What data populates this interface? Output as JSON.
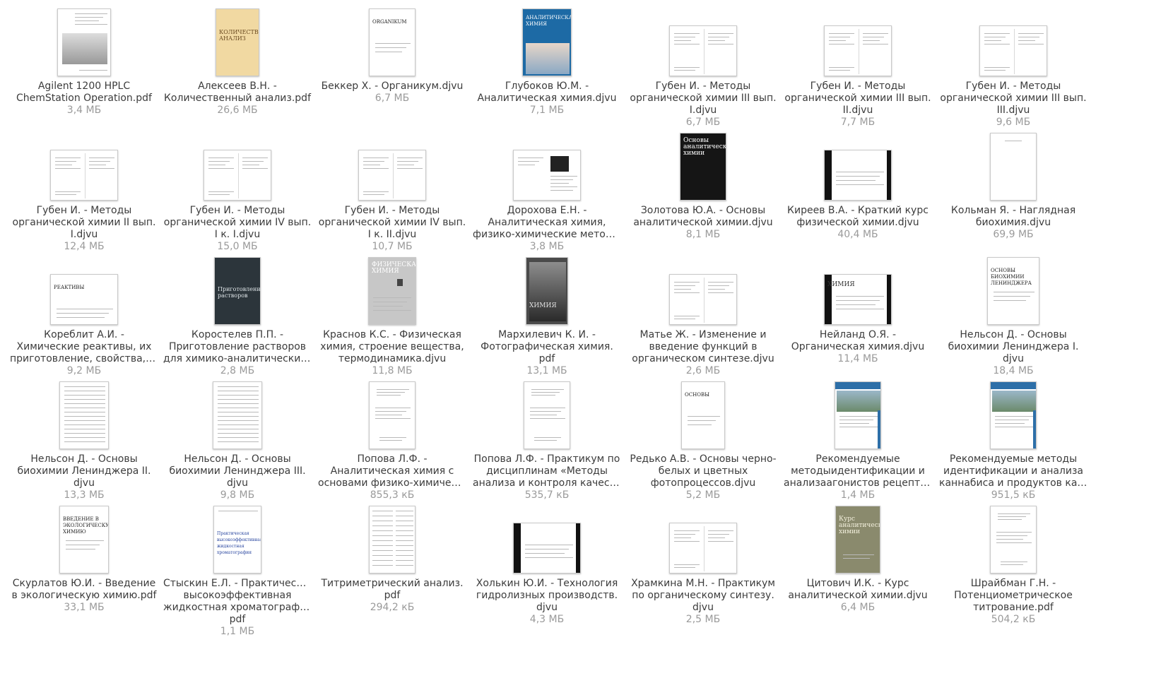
{
  "files": [
    {
      "lines": [
        "Agilent 1200 HPLC",
        "ChemStation Operation.pdf"
      ],
      "size": "3,4 МБ",
      "thumb": "photo-cover",
      "ttext": ""
    },
    {
      "lines": [
        "Алексеев В.Н. -",
        "Количественный анализ.pdf"
      ],
      "size": "26,6 МБ",
      "thumb": "yellow-cover",
      "ttext": "КОЛИЧЕСТВЕННЫЙ АНАЛИЗ"
    },
    {
      "lines": [
        "Беккер Х. - Органикум.djvu"
      ],
      "size": "6,7 МБ",
      "thumb": "title-page",
      "ttext": "ORGANIKUM"
    },
    {
      "lines": [
        "Глубоков Ю.М. -",
        "Аналитическая химия.djvu"
      ],
      "size": "7,1 МБ",
      "thumb": "blue-cover",
      "ttext": "АНАЛИТИЧЕСКАЯ ХИМИЯ"
    },
    {
      "lines": [
        "Губен И. - Методы",
        "органической химии III вып.",
        "I.djvu"
      ],
      "size": "6,7 МБ",
      "thumb": "spread",
      "ttext": ""
    },
    {
      "lines": [
        "Губен И. - Методы",
        "органической химии III вып.",
        "II.djvu"
      ],
      "size": "7,7 МБ",
      "thumb": "spread",
      "ttext": ""
    },
    {
      "lines": [
        "Губен И. - Методы",
        "органической химии III вып.",
        "III.djvu"
      ],
      "size": "9,6 МБ",
      "thumb": "spread",
      "ttext": ""
    },
    {
      "lines": [
        "Губен И. - Методы",
        "органической химии II вып.",
        "I.djvu"
      ],
      "size": "12,4 МБ",
      "thumb": "spread",
      "ttext": ""
    },
    {
      "lines": [
        "Губен И. - Методы",
        "органической химии IV вып.",
        "I к. I.djvu"
      ],
      "size": "15,0 МБ",
      "thumb": "spread",
      "ttext": ""
    },
    {
      "lines": [
        "Губен И. - Методы",
        "органической химии IV вып.",
        "I к. II.djvu"
      ],
      "size": "10,7 МБ",
      "thumb": "spread",
      "ttext": ""
    },
    {
      "lines": [
        "Дорохова Е.Н. -",
        "Аналитическая химия,",
        "физико-химические методы анализа.djvu"
      ],
      "size": "3,8 МБ",
      "thumb": "spread-bold",
      "ttext": ""
    },
    {
      "lines": [
        "Золотова Ю.А. - Основы",
        "аналитической химии.djvu"
      ],
      "size": "8,1 МБ",
      "thumb": "black-cover",
      "ttext": "Основы аналитической химии"
    },
    {
      "lines": [
        "Киреев В.А. - Краткий курс",
        "физической химии.djvu"
      ],
      "size": "40,4 МБ",
      "thumb": "scan-dark",
      "ttext": ""
    },
    {
      "lines": [
        "Кольман Я. - Наглядная",
        "биохимия.djvu"
      ],
      "size": "69,9 МБ",
      "thumb": "blank",
      "ttext": ""
    },
    {
      "lines": [
        "Кореблит А.И. -",
        "Химические реактивы, их",
        "приготовление, свойства, испытание и применение.djvu"
      ],
      "size": "9,2 МБ",
      "thumb": "title-page",
      "ttext": "РЕАКТИВЫ"
    },
    {
      "lines": [
        "Коростелев П.П. -",
        "Приготовление растворов",
        "для химико-аналитических работ.djvu"
      ],
      "size": "2,8 МБ",
      "thumb": "dark-cover",
      "ttext": "Приготовление растворов"
    },
    {
      "lines": [
        "Краснов К.С. - Физическая",
        "химия, строение вещества,",
        "термодинамика.djvu"
      ],
      "size": "11,8 МБ",
      "thumb": "gray-cover",
      "ttext": "ФИЗИЧЕСКАЯ ХИМИЯ"
    },
    {
      "lines": [
        "Мархилевич К. И. -",
        "Фотографическая химия.",
        "pdf"
      ],
      "size": "13,1 МБ",
      "thumb": "photo-dark",
      "ttext": "ХИМИЯ"
    },
    {
      "lines": [
        "Матье Ж. - Изменение и",
        "введение функций в",
        "органическом синтезе.djvu"
      ],
      "size": "2,6 МБ",
      "thumb": "spread",
      "ttext": ""
    },
    {
      "lines": [
        "Нейланд О.Я. -",
        "Органическая химия.djvu"
      ],
      "size": "11,4 МБ",
      "thumb": "scan-dark",
      "ttext": "ХИМИЯ"
    },
    {
      "lines": [
        "Нельсон Д. - Основы",
        "биохимии Ленинджера I.",
        "djvu"
      ],
      "size": "18,4 МБ",
      "thumb": "title-page",
      "ttext": "ОСНОВЫ БИОХИМИИ ЛЕНИНДЖЕРА"
    },
    {
      "lines": [
        "Нельсон Д. - Основы",
        "биохимии Ленинджера II.",
        "djvu"
      ],
      "size": "13,3 МБ",
      "thumb": "text-page",
      "ttext": ""
    },
    {
      "lines": [
        "Нельсон Д. - Основы",
        "биохимии Ленинджера III.",
        "djvu"
      ],
      "size": "9,8 МБ",
      "thumb": "text-page",
      "ttext": ""
    },
    {
      "lines": [
        "Попова Л.Ф. -",
        "Аналитическая химия с",
        "основами физико-химических методов.djvu"
      ],
      "size": "855,3 кБ",
      "thumb": "title-page",
      "ttext": ""
    },
    {
      "lines": [
        "Попова Л.Ф. - Практикум по",
        "дисциплинам «Методы",
        "анализа и контроля качества».pdf"
      ],
      "size": "535,7 кБ",
      "thumb": "title-page",
      "ttext": ""
    },
    {
      "lines": [
        "Редько А.В. - Основы черно-",
        "белых и цветных",
        "фотопроцессов.djvu"
      ],
      "size": "5,2 МБ",
      "thumb": "title-page",
      "ttext": "ОСНОВЫ"
    },
    {
      "lines": [
        "Рекомендуемые",
        "методыидентификации и",
        "анализаагонистов рецепторов.pdf"
      ],
      "size": "1,4 МБ",
      "thumb": "un-cover",
      "ttext": ""
    },
    {
      "lines": [
        "Рекомендуемые методы",
        "идентификации и анализа",
        "каннабиса и продуктов каннабиса.pdf"
      ],
      "size": "951,5 кБ",
      "thumb": "un-cover",
      "ttext": ""
    },
    {
      "lines": [
        "Скурлатов Ю.И. - Введение",
        "в экологическую химию.pdf"
      ],
      "size": "33,1 МБ",
      "thumb": "title-page",
      "ttext": "ВВЕДЕНИЕ В ЭКОЛОГИЧЕСКУЮ ХИМИЮ"
    },
    {
      "lines": [
        "Стыскин Е.Л. - Практическая",
        "высокоэффективная",
        "жидкостная хроматография.",
        "pdf"
      ],
      "size": "1,1 МБ",
      "thumb": "title-blue",
      "ttext": "Практическая высокоэффективная жидкостная хроматография"
    },
    {
      "lines": [
        "Титриметрический анализ.",
        "pdf"
      ],
      "size": "294,2 кБ",
      "thumb": "table-page",
      "ttext": ""
    },
    {
      "lines": [
        "Холькин Ю.И. - Технология",
        "гидролизных производств.",
        "djvu"
      ],
      "size": "4,3 МБ",
      "thumb": "scan-dark",
      "ttext": ""
    },
    {
      "lines": [
        "Храмкина М.Н. - Практикум",
        "по органическому синтезу.",
        "djvu"
      ],
      "size": "2,5 МБ",
      "thumb": "spread",
      "ttext": ""
    },
    {
      "lines": [
        "Цитович И.К. - Курс",
        "аналитической химии.djvu"
      ],
      "size": "6,4 МБ",
      "thumb": "olive-cover",
      "ttext": "Курс аналитической химии"
    },
    {
      "lines": [
        "Шрайбман Г.Н. -",
        "Потенциометрическое",
        "титрование.pdf"
      ],
      "size": "504,2 кБ",
      "thumb": "title-page",
      "ttext": ""
    }
  ]
}
